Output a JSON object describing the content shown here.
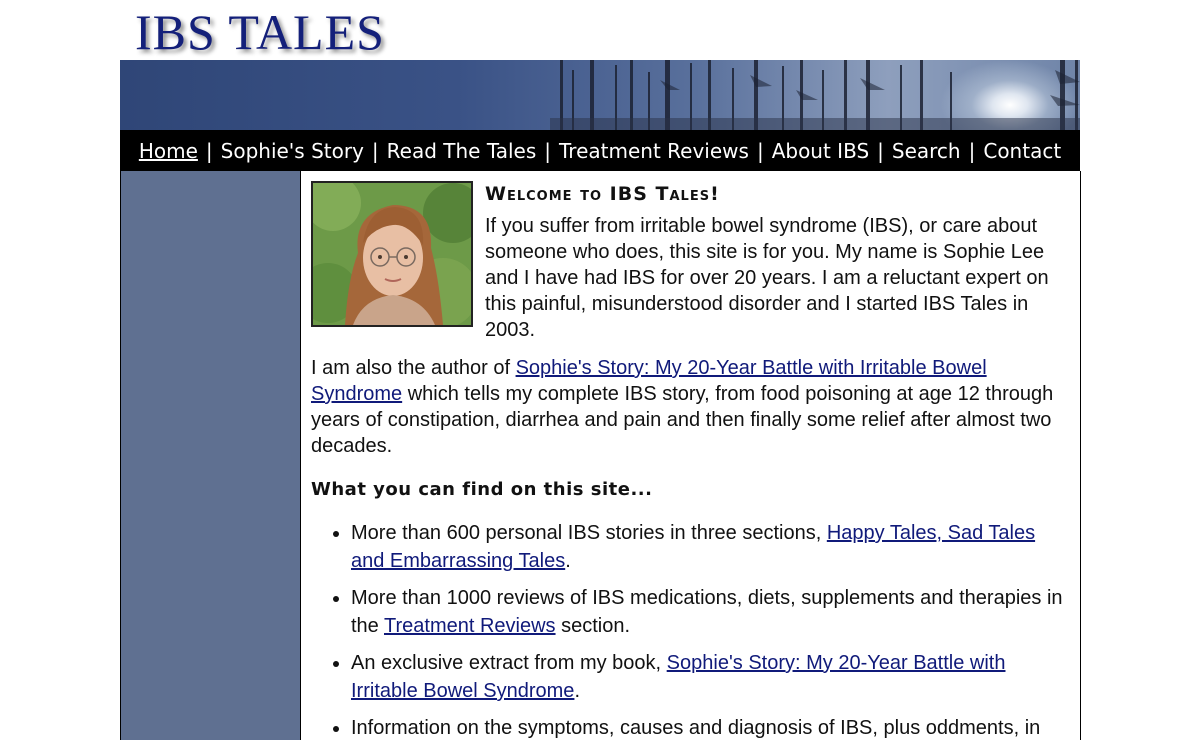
{
  "site": {
    "logo_text": "IBS TALES"
  },
  "nav": {
    "home": "Home",
    "sophies_story": "Sophie's Story",
    "read_tales": "Read The Tales",
    "treatment_reviews": "Treatment Reviews",
    "about_ibs": "About IBS",
    "search": "Search",
    "contact": "Contact",
    "separator": "|"
  },
  "main": {
    "welcome_heading": "Welcome to IBS Tales!",
    "intro": "If you suffer from irritable bowel syndrome (IBS), or care about someone who does, this site is for you. My name is Sophie Lee and I have had IBS for over 20 years. I am a reluctant expert on this painful, misunderstood disorder and I started IBS Tales in 2003.",
    "author_prefix": "I am also the author of ",
    "book_link": "Sophie's Story: My 20-Year Battle with Irritable Bowel Syndrome",
    "author_suffix": " which tells my complete IBS story, from food poisoning at age 12 through years of constipation, diarrhea and pain and then finally some relief after almost two decades.",
    "find_heading": "What you can find on this site...",
    "bullets": [
      {
        "prefix": "More than 600 personal IBS stories in three sections, ",
        "link": "Happy Tales, Sad Tales and Embarrassing Tales",
        "suffix": "."
      },
      {
        "prefix": "More than 1000 reviews of IBS medications, diets, supplements and therapies in the ",
        "link": "Treatment Reviews",
        "suffix": " section."
      },
      {
        "prefix": "An exclusive extract from my book, ",
        "link": "Sophie's Story: My 20-Year Battle with Irritable Bowel Syndrome",
        "suffix": "."
      },
      {
        "prefix": "Information on the symptoms, causes and diagnosis of IBS, plus oddments, in"
      }
    ]
  },
  "colors": {
    "logo": "#14207a",
    "navbar_bg": "#000000",
    "sidebar_bg": "#5f7091",
    "link": "#101a7a"
  }
}
